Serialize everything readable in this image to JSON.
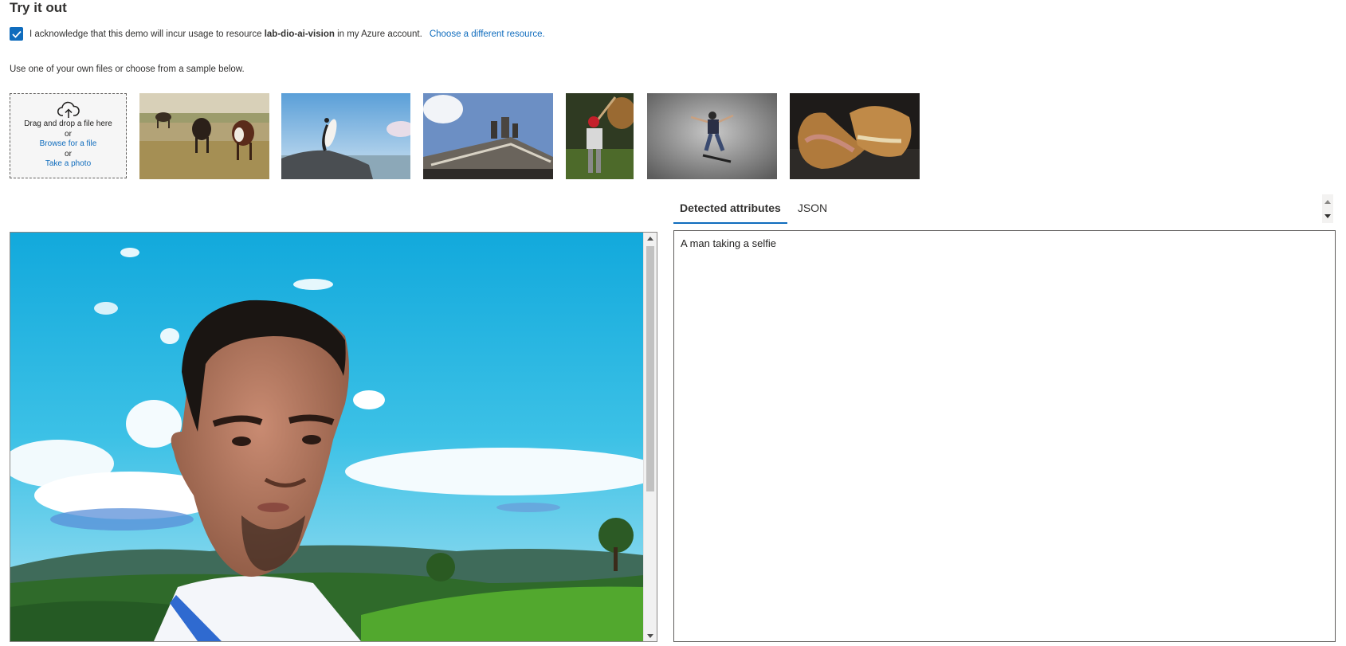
{
  "title": "Try it out",
  "acknowledge": {
    "text_before": "I acknowledge that this demo will incur usage to resource",
    "resource": "lab-dio-ai-vision",
    "text_after": "in my Azure account.",
    "link": "Choose a different resource.",
    "checked": true
  },
  "hint": "Use one of your own files or choose from a sample below.",
  "dropzone": {
    "line1": "Drag and drop a file here",
    "or1": "or",
    "browse": "Browse for a file",
    "or2": "or",
    "photo": "Take a photo",
    "icon": "cloud-upload-icon"
  },
  "samples": [
    "cows-in-field",
    "surfer-on-rock",
    "building-statues",
    "baseball-batter",
    "skateboarder",
    "grilled-sandwich"
  ],
  "tabs": [
    "Detected attributes",
    "JSON"
  ],
  "active_tab": "Detected attributes",
  "result": {
    "caption": "A man taking a selfie"
  },
  "colors": {
    "accent": "#0f6cbd",
    "border": "#8a8886"
  }
}
